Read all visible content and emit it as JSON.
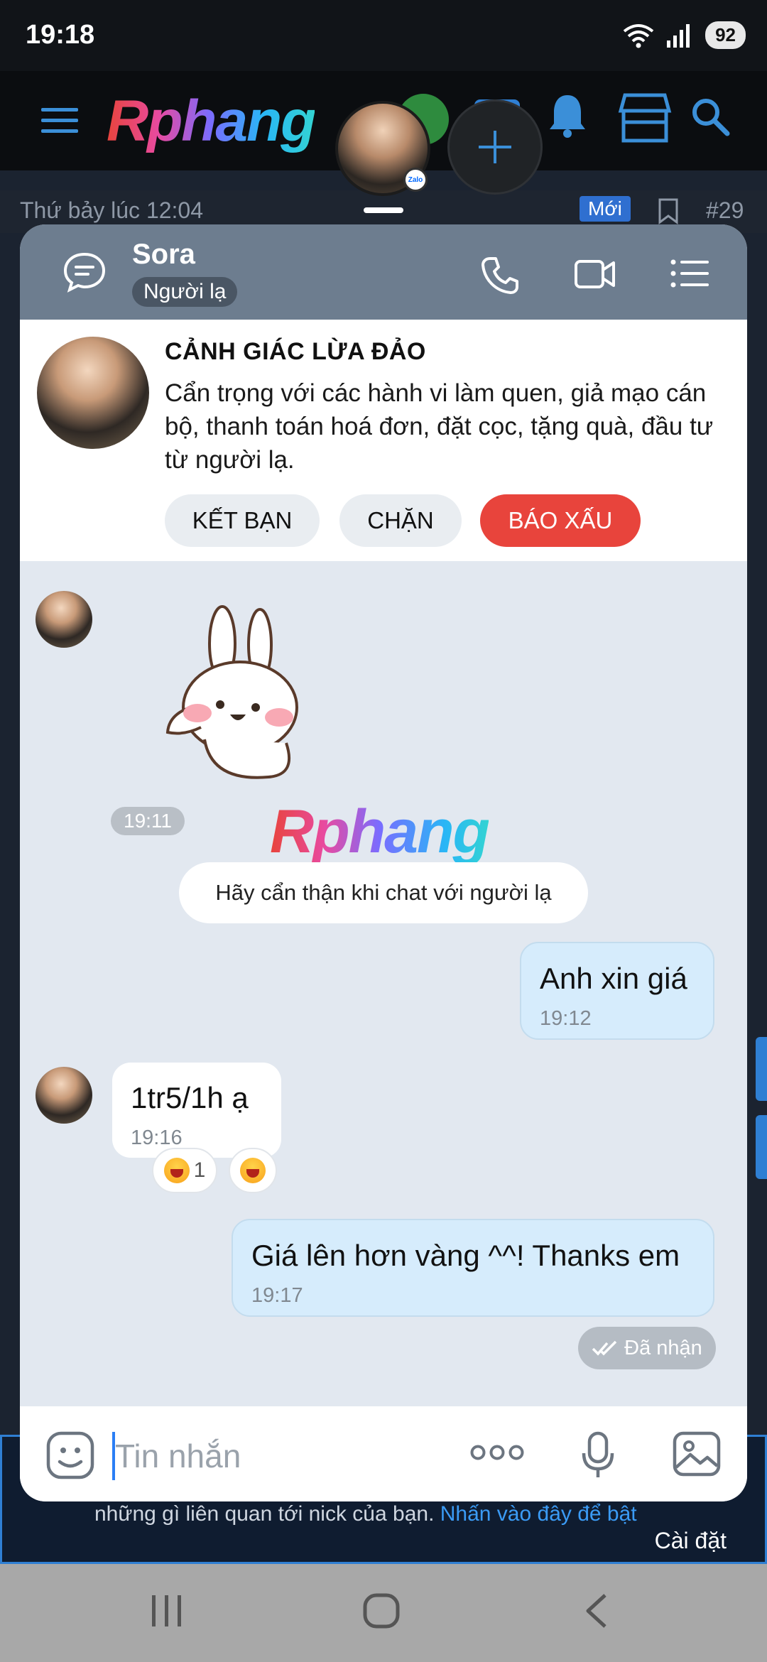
{
  "status_bar": {
    "time": "19:18",
    "battery": "92"
  },
  "forum": {
    "logo": "Rphang",
    "post_date": "Thứ bảy lúc 12:04",
    "new_badge": "Mới",
    "post_number": "#29",
    "notice_text": "những gì liên quan tới nick của bạn.",
    "notice_link": "Nhấn vào đây để bật",
    "settings_label": "Cài đặt"
  },
  "chathead": {
    "badge": "Zalo"
  },
  "chat": {
    "contact_name": "Sora",
    "contact_tag": "Người lạ",
    "warning": {
      "title": "CẢNH GIÁC LỪA ĐẢO",
      "text": "Cẩn trọng với các hành vi làm quen, giả mạo cán bộ, thanh toán hoá đơn, đặt cọc, tặng quà, đầu tư từ người lạ.",
      "add_friend": "KẾT BẠN",
      "block": "CHẶN",
      "report": "BÁO XẤU"
    },
    "sticker_time": "19:11",
    "watermark": "Rphang",
    "system_notice": "Hãy cẩn thận khi chat với người lạ",
    "messages": [
      {
        "from": "me",
        "text": "Anh xin giá",
        "time": "19:12"
      },
      {
        "from": "them",
        "text": "1tr5/1h ạ",
        "time": "19:16",
        "reaction_count": "1"
      },
      {
        "from": "me",
        "text": "Giá lên hơn vàng ^^! Thanks em",
        "time": "19:17"
      }
    ],
    "delivery_status": "Đã nhận",
    "composer_placeholder": "Tin nhắn"
  },
  "colors": {
    "accent": "#2f7fd3",
    "header": "#6d7d8f",
    "report": "#e8443c",
    "my_bubble": "#d6ecfc"
  }
}
